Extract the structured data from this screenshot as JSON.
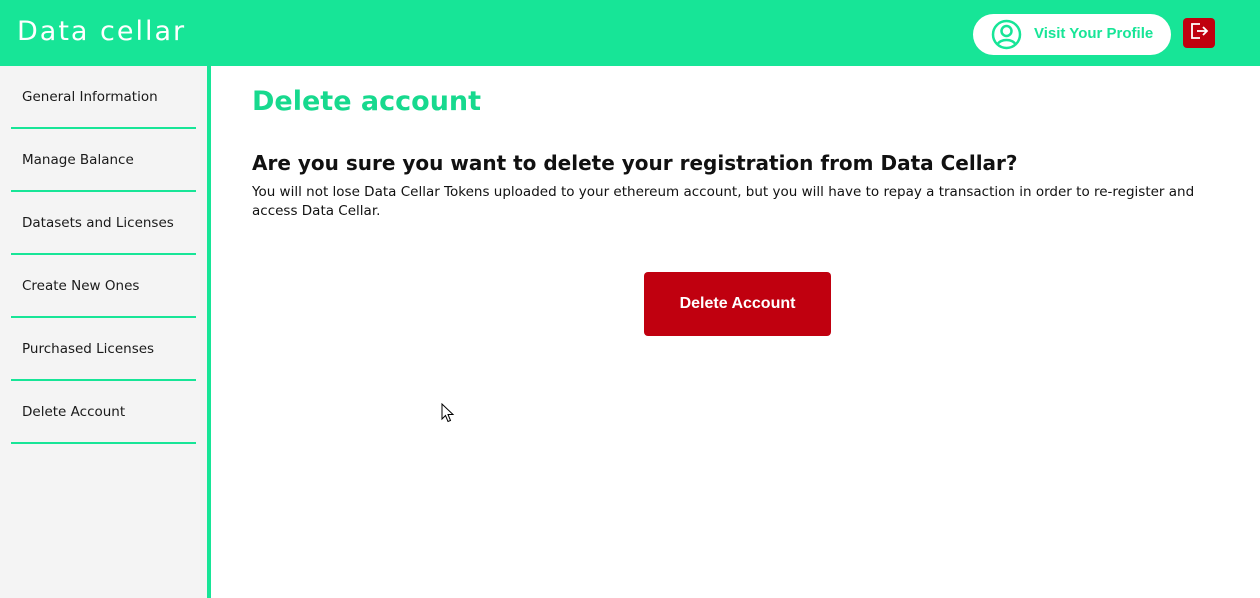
{
  "header": {
    "logo_text": "Data cellar",
    "profile_button_label": "Visit Your Profile",
    "profile_icon": "user-circle-icon",
    "logout_icon": "logout-icon",
    "brand_color": "#17e597",
    "danger_color": "#c0000f"
  },
  "sidebar": {
    "items": [
      {
        "label": "General Information"
      },
      {
        "label": "Manage Balance"
      },
      {
        "label": "Datasets and Licenses"
      },
      {
        "label": "Create New Ones"
      },
      {
        "label": "Purchased Licenses"
      },
      {
        "label": "Delete Account"
      }
    ]
  },
  "main": {
    "title": "Delete account",
    "question": "Are you sure you want to delete your registration from Data Cellar?",
    "description": "You will not lose Data Cellar Tokens uploaded to your ethereum account, but you will have to repay a transaction in order to re-register and access Data Cellar.",
    "delete_button_label": "Delete Account"
  }
}
